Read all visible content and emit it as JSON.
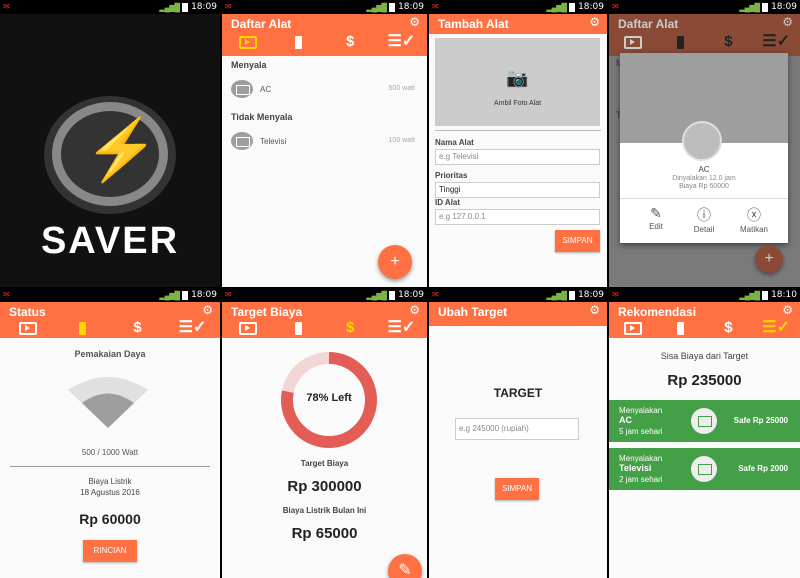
{
  "status_bar": {
    "time": "18:09",
    "time_last": "18:10"
  },
  "splash": {
    "brand": "SAVER"
  },
  "tabs": {
    "tv": "tv-icon",
    "battery": "battery-icon",
    "cost": "$",
    "recommend": "list-check-icon"
  },
  "daftar_alat": {
    "title": "Daftar Alat",
    "on_header": "Menyala",
    "off_header": "Tidak Menyala",
    "on_items": [
      {
        "name": "AC",
        "watt": "500 watt"
      }
    ],
    "off_items": [
      {
        "name": "Televisi",
        "watt": "100 watt"
      }
    ],
    "fab": "+"
  },
  "tambah_alat": {
    "title": "Tambah Alat",
    "photo_label": "Ambil Foto Alat",
    "name_label": "Nama Alat",
    "name_placeholder": "e.g Televisi",
    "priority_label": "Prioritas",
    "priority_value": "Tinggi",
    "id_label": "ID Alat",
    "id_placeholder": "e.g 127.0.0.1",
    "save": "SIMPAN"
  },
  "dialog": {
    "title": "Daftar Alat",
    "device": "AC",
    "line1": "Dinyalakan 12.0 jam",
    "line2": "Biaya Rp 60000",
    "edit": "Edit",
    "detail": "Detail",
    "off": "Matikan",
    "bg_header1": "M",
    "bg_header2": "T"
  },
  "status": {
    "title": "Status",
    "usage_label": "Pemakaian Daya",
    "usage_value": "500 / 1000 Watt",
    "bill_label": "Biaya Listrik",
    "bill_date": "18 Agustus 2016",
    "bill_amount": "Rp 60000",
    "details": "RINCIAN"
  },
  "target_biaya": {
    "title": "Target Biaya",
    "left_text": "78% Left",
    "target_label": "Target Biaya",
    "target_value": "Rp 300000",
    "month_label": "Biaya Listrik Bulan Ini",
    "month_value": "Rp 65000"
  },
  "ubah_target": {
    "title": "Ubah Target",
    "heading": "TARGET",
    "placeholder": "e.g 245000 (rupiah)",
    "save": "SIMPAN"
  },
  "rekomendasi": {
    "title": "Rekomendasi",
    "remaining_label": "Sisa Biaya dari Target",
    "remaining_value": "Rp 235000",
    "items": [
      {
        "l1": "Menyalakan",
        "device": "AC",
        "hours": "5 jam sehari",
        "safe": "Safe Rp 25000"
      },
      {
        "l1": "Menyalakan",
        "device": "Televisi",
        "hours": "2 jam sehari",
        "safe": "Safe Rp 2000"
      }
    ]
  },
  "colors": {
    "accent": "#ff7043",
    "green": "#43a047",
    "tab_active": "#ffd600"
  }
}
